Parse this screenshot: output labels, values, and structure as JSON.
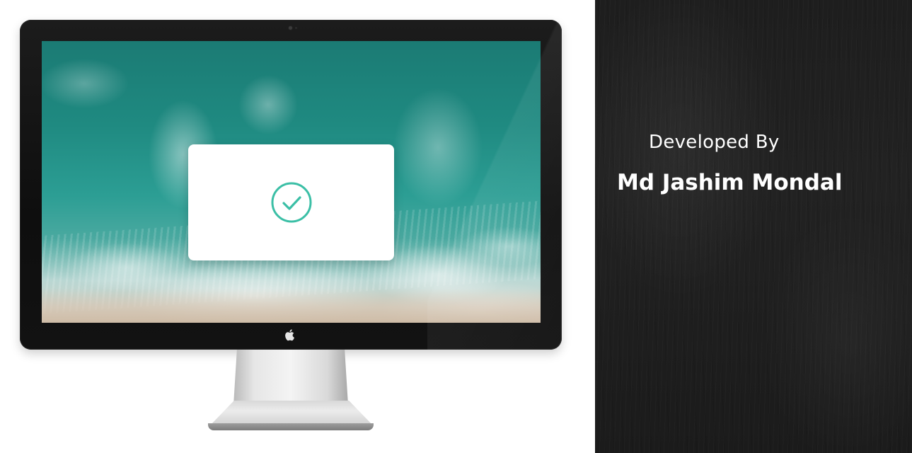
{
  "credit": {
    "heading": "Developed By",
    "name": "Md Jashim Mondal"
  },
  "screen": {
    "wallpaper": "aerial-ocean-waves",
    "modal": {
      "icon": "check-circle-icon",
      "accent_color": "#3bbfa6"
    }
  },
  "device": {
    "brand_icon": "apple-logo-icon"
  },
  "colors": {
    "panel_background": "#1f1f1f",
    "text": "#ffffff",
    "bezel": "#141414"
  }
}
